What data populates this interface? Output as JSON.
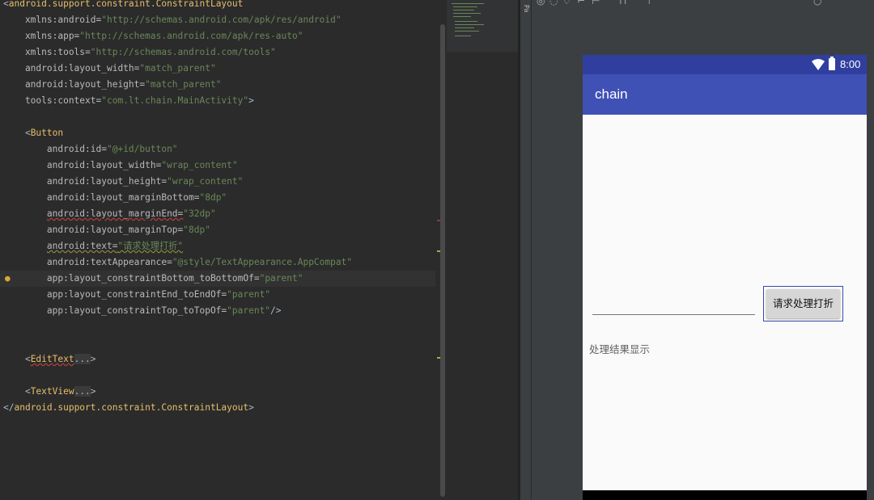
{
  "code_lines": [
    [
      {
        "t": "<",
        "c": "c-punct"
      },
      {
        "t": "android.support.constraint.ConstraintLayout",
        "c": "c-tag"
      }
    ],
    [
      {
        "t": "    xmlns:android=",
        "c": "c-attr"
      },
      {
        "t": "\"http://schemas.android.com/apk/res/android\"",
        "c": "c-val"
      }
    ],
    [
      {
        "t": "    xmlns:app=",
        "c": "c-attr"
      },
      {
        "t": "\"http://schemas.android.com/apk/res-auto\"",
        "c": "c-val"
      }
    ],
    [
      {
        "t": "    xmlns:tools=",
        "c": "c-attr"
      },
      {
        "t": "\"http://schemas.android.com/tools\"",
        "c": "c-val"
      }
    ],
    [
      {
        "t": "    android:layout_width=",
        "c": "c-attr"
      },
      {
        "t": "\"match_parent\"",
        "c": "c-val"
      }
    ],
    [
      {
        "t": "    android:layout_height=",
        "c": "c-attr"
      },
      {
        "t": "\"match_parent\"",
        "c": "c-val"
      }
    ],
    [
      {
        "t": "    tools:context=",
        "c": "c-attr"
      },
      {
        "t": "\"com.lt.chain.MainActivity\"",
        "c": "c-val"
      },
      {
        "t": ">",
        "c": "c-punct"
      }
    ],
    [],
    [
      {
        "t": "    <",
        "c": "c-punct"
      },
      {
        "t": "Button",
        "c": "c-tag"
      }
    ],
    [
      {
        "t": "        android:id=",
        "c": "c-attr"
      },
      {
        "t": "\"@+id/button\"",
        "c": "c-val"
      }
    ],
    [
      {
        "t": "        android:layout_width=",
        "c": "c-attr"
      },
      {
        "t": "\"wrap_content\"",
        "c": "c-val"
      }
    ],
    [
      {
        "t": "        android:layout_height=",
        "c": "c-attr"
      },
      {
        "t": "\"wrap_content\"",
        "c": "c-val"
      }
    ],
    [
      {
        "t": "        android:layout_marginBottom=",
        "c": "c-attr"
      },
      {
        "t": "\"8dp\"",
        "c": "c-val"
      }
    ],
    [
      {
        "t": "        ",
        "c": "c-attr"
      },
      {
        "t": "android:layout_marginEnd=",
        "c": "c-attr c-err"
      },
      {
        "t": "\"32dp\"",
        "c": "c-val"
      }
    ],
    [
      {
        "t": "        android:layout_marginTop=",
        "c": "c-attr"
      },
      {
        "t": "\"8dp\"",
        "c": "c-val"
      }
    ],
    [
      {
        "t": "        ",
        "c": "c-attr"
      },
      {
        "t": "android:text=",
        "c": "c-attr c-warn"
      },
      {
        "t": "\"请求处理打折\"",
        "c": "c-val c-warn"
      }
    ],
    [
      {
        "t": "        android:textAppearance=",
        "c": "c-attr"
      },
      {
        "t": "\"@style/TextAppearance.AppCompat\"",
        "c": "c-val"
      }
    ],
    [
      {
        "t": "        app:layout_constraintBottom_toBottomOf=",
        "c": "c-attr"
      },
      {
        "t": "\"parent\"",
        "c": "c-val"
      }
    ],
    [
      {
        "t": "        app:layout_constraintEnd_toEndOf=",
        "c": "c-attr"
      },
      {
        "t": "\"parent\"",
        "c": "c-val"
      }
    ],
    [
      {
        "t": "        app:layout_constraintTop_toTopOf=",
        "c": "c-attr"
      },
      {
        "t": "\"parent\"",
        "c": "c-val"
      },
      {
        "t": "/>",
        "c": "c-punct"
      }
    ],
    [],
    [],
    [
      {
        "t": "    <",
        "c": "c-punct"
      },
      {
        "t": "EditText",
        "c": "c-tag c-err"
      },
      {
        "t": "...",
        "c": "c-fold"
      },
      {
        "t": ">",
        "c": "c-punct"
      }
    ],
    [],
    [
      {
        "t": "    <",
        "c": "c-punct"
      },
      {
        "t": "TextView",
        "c": "c-tag"
      },
      {
        "t": "...",
        "c": "c-fold"
      },
      {
        "t": ">",
        "c": "c-punct"
      }
    ],
    [
      {
        "t": "</",
        "c": "c-punct"
      },
      {
        "t": "android.support.constraint.ConstraintLayout",
        "c": "c-tag"
      },
      {
        "t": ">",
        "c": "c-punct"
      }
    ]
  ],
  "current_line_index": 17,
  "palette_label": "Pa",
  "colors": {
    "status_bar": "#303f9f",
    "app_bar": "#3f51b5",
    "selection_outline": "#3949ab",
    "button_bg": "#d6d6d6"
  },
  "phone": {
    "clock": "8:00",
    "app_title": "chain",
    "edit_text_value": "",
    "button_label": "请求处理打折",
    "result_text": "处理结果显示"
  }
}
